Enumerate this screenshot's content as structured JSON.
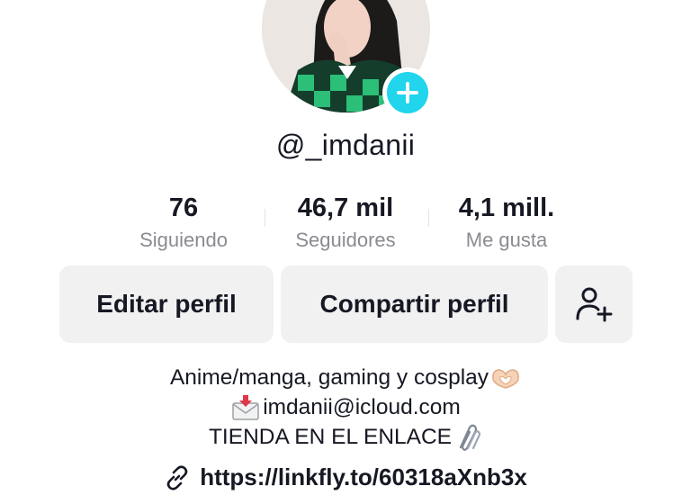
{
  "profile": {
    "username": "@_imdanii"
  },
  "stats": [
    {
      "value": "76",
      "label": "Siguiendo"
    },
    {
      "value": "46,7 mil",
      "label": "Seguidores"
    },
    {
      "value": "4,1 mill.",
      "label": "Me gusta"
    }
  ],
  "actions": {
    "edit_label": "Editar perfil",
    "share_label": "Compartir perfil"
  },
  "bio": {
    "line1": "Anime/manga, gaming y cosplay",
    "line2": "imdanii@icloud.com",
    "line3": "TIENDA EN EL ENLACE"
  },
  "link": {
    "url": "https://linkfly.to/60318aXnb3x"
  },
  "icons": {
    "avatar_add": "plus-icon",
    "add_friend": "person-add-icon",
    "bio_heart": "heart-hands-emoji",
    "bio_mail": "incoming-envelope-emoji",
    "bio_clip": "paperclips-emoji",
    "link": "link-chain-icon"
  },
  "colors": {
    "accent": "#20d5ec",
    "text": "#161823",
    "secondary_text": "#8a8b91",
    "button_bg": "#f1f1f2"
  }
}
